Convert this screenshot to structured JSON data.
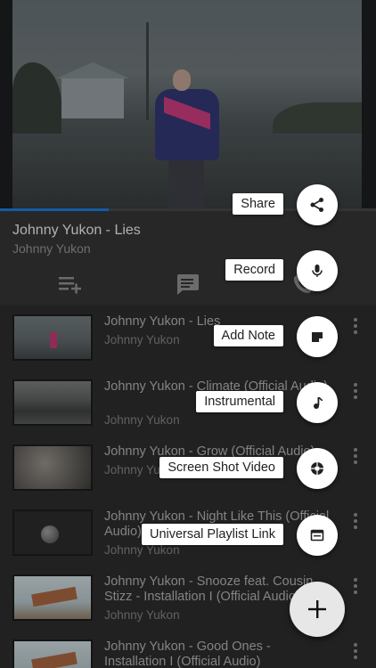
{
  "now_playing": {
    "title": "Johnny Yukon - Lies",
    "artist": "Johnny Yukon",
    "progress": 0.29,
    "accent_color": "#1976d2"
  },
  "actions": [
    {
      "icon": "playlist-add-icon"
    },
    {
      "icon": "comment-icon"
    },
    {
      "icon": "phone-icon"
    }
  ],
  "playlist": [
    {
      "title": "Johnny Yukon - Lies",
      "artist": "Johnny Yukon"
    },
    {
      "title": "Johnny Yukon - Climate (Official Audio)",
      "artist": "Johnny Yukon"
    },
    {
      "title": "Johnny Yukon - Grow (Official Audio)",
      "artist": "Johnny Yukon"
    },
    {
      "title": "Johnny Yukon - Night Like This (Official Audio)",
      "artist": "Johnny Yukon"
    },
    {
      "title": "Johnny Yukon - Snooze feat. Cousin Stizz - Installation I (Official Audio)",
      "artist": "Johnny Yukon"
    },
    {
      "title": "Johnny Yukon - Good Ones - Installation I (Official Audio)",
      "artist": ""
    }
  ],
  "speed_dial": [
    {
      "label": "Share",
      "icon": "share-icon"
    },
    {
      "label": "Record",
      "icon": "mic-icon"
    },
    {
      "label": "Add Note",
      "icon": "note-icon"
    },
    {
      "label": "Instrumental",
      "icon": "music-note-icon"
    },
    {
      "label": "Screen Shot Video",
      "icon": "camera-shutter-icon"
    },
    {
      "label": "Universal Playlist Link",
      "icon": "browser-window-icon"
    }
  ],
  "fab": {
    "icon": "plus-icon"
  }
}
